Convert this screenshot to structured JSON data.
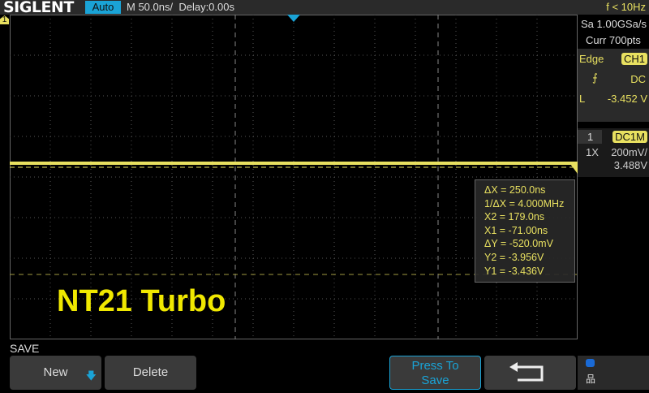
{
  "header": {
    "brand": "SIGLENT",
    "trigger_mode": "Auto",
    "timebase": "M 50.0ns/",
    "delay": "Delay:0.00s",
    "frequency": "f < 10Hz"
  },
  "acquisition": {
    "sample_rate": "Sa 1.00GSa/s",
    "memory": "Curr 700pts"
  },
  "trigger": {
    "type": "Edge",
    "source": "CH1",
    "slope_icon": "rising-edge-icon",
    "coupling": "DC",
    "level_label": "L",
    "level": "-3.452 V"
  },
  "channel": {
    "number": "1",
    "coupling": "DC1M",
    "probe": "1X",
    "scale": "200mV/",
    "offset": "3.488V"
  },
  "measurements": [
    "ΔX = 250.0ns",
    "1/ΔX = 4.000MHz",
    "X2 = 179.0ns",
    "X1 = -71.00ns",
    "ΔY = -520.0mV",
    "Y2 = -3.956V",
    "Y1 = -3.436V"
  ],
  "overlay_text": "NT21 Turbo",
  "channel_marker": "1",
  "menu": {
    "title": "SAVE",
    "new": "New",
    "delete": "Delete",
    "press_to_save_1": "Press To",
    "press_to_save_2": "Save"
  },
  "colors": {
    "ch1": "#e8e060",
    "accent": "#1aa3d6"
  }
}
